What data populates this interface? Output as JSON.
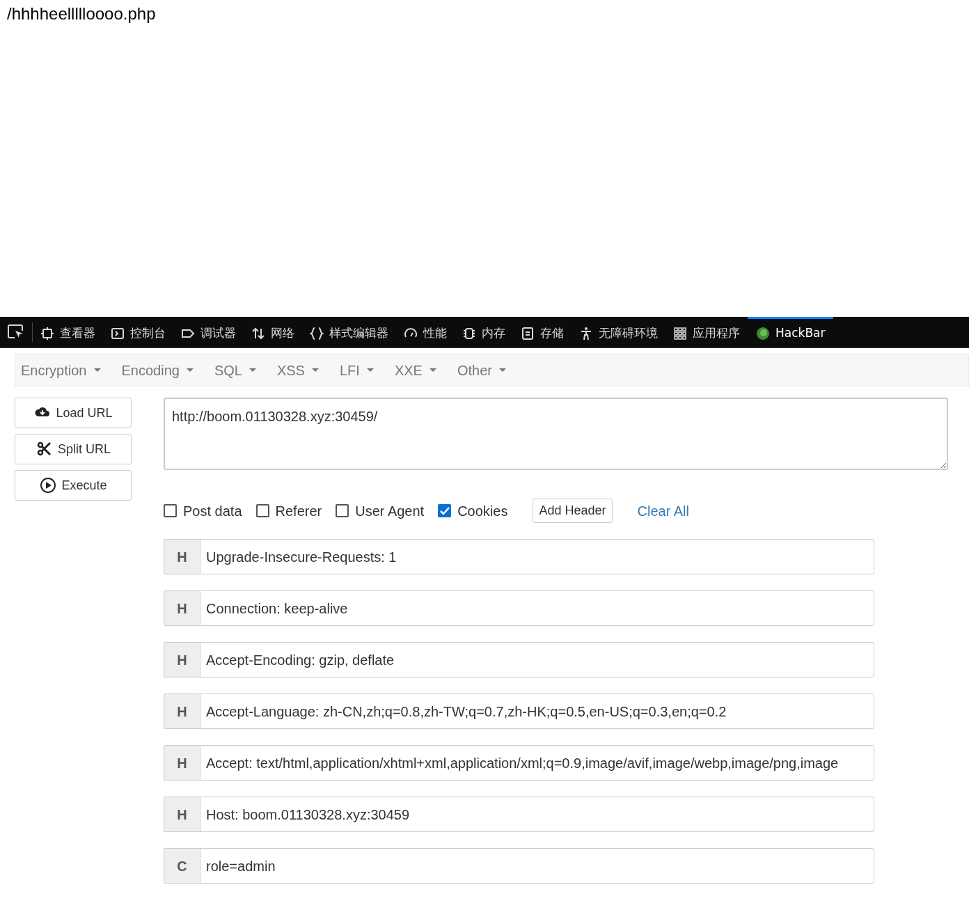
{
  "page_text": "/hhhheellllloooo.php",
  "devtools": {
    "tabs": [
      {
        "label": "查看器",
        "selected": false
      },
      {
        "label": "控制台",
        "selected": false
      },
      {
        "label": "调试器",
        "selected": false
      },
      {
        "label": "网络",
        "selected": false
      },
      {
        "label": "样式编辑器",
        "selected": false
      },
      {
        "label": "性能",
        "selected": false
      },
      {
        "label": "内存",
        "selected": false
      },
      {
        "label": "存储",
        "selected": false
      },
      {
        "label": "无障碍环境",
        "selected": false
      },
      {
        "label": "应用程序",
        "selected": false
      },
      {
        "label": "HackBar",
        "selected": true
      }
    ]
  },
  "hackbar": {
    "menus": [
      "Encryption",
      "Encoding",
      "SQL",
      "XSS",
      "LFI",
      "XXE",
      "Other"
    ],
    "buttons": [
      "Load URL",
      "Split URL",
      "Execute"
    ],
    "url": "http://boom.01130328.xyz:30459/",
    "options": [
      {
        "label": "Post data",
        "checked": false
      },
      {
        "label": "Referer",
        "checked": false
      },
      {
        "label": "User Agent",
        "checked": false
      },
      {
        "label": "Cookies",
        "checked": true
      }
    ],
    "add_header": "Add Header",
    "clear_all": "Clear All",
    "headers": [
      {
        "type": "H",
        "value": "Upgrade-Insecure-Requests: 1"
      },
      {
        "type": "H",
        "value": "Connection: keep-alive"
      },
      {
        "type": "H",
        "value": "Accept-Encoding: gzip, deflate"
      },
      {
        "type": "H",
        "value": "Accept-Language: zh-CN,zh;q=0.8,zh-TW;q=0.7,zh-HK;q=0.5,en-US;q=0.3,en;q=0.2"
      },
      {
        "type": "H",
        "value": "Accept: text/html,application/xhtml+xml,application/xml;q=0.9,image/avif,image/webp,image/png,image"
      },
      {
        "type": "H",
        "value": "Host: boom.01130328.xyz:30459"
      },
      {
        "type": "C",
        "value": "role=admin"
      }
    ]
  }
}
